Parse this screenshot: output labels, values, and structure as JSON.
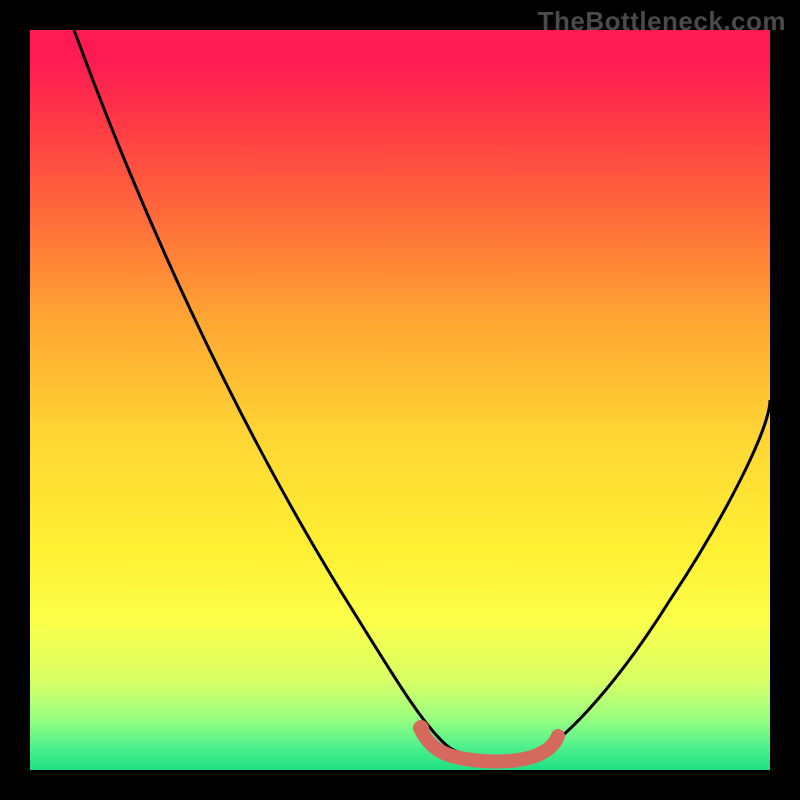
{
  "watermark": "TheBottleneck.com",
  "chart_data": {
    "type": "line",
    "title": "",
    "xlabel": "",
    "ylabel": "",
    "xlim": [
      0,
      100
    ],
    "ylim": [
      0,
      100
    ],
    "gradient_stops": [
      {
        "pos": 0,
        "color": "#ff1a53"
      },
      {
        "pos": 25,
        "color": "#ff6b3a"
      },
      {
        "pos": 55,
        "color": "#ffd633"
      },
      {
        "pos": 80,
        "color": "#fbff4a"
      },
      {
        "pos": 97,
        "color": "#4cf08c"
      },
      {
        "pos": 100,
        "color": "#1ee083"
      }
    ],
    "series": [
      {
        "name": "bottleneck-curve",
        "color": "#000000",
        "points": [
          {
            "x": 6,
            "y": 100
          },
          {
            "x": 20,
            "y": 70
          },
          {
            "x": 35,
            "y": 38
          },
          {
            "x": 48,
            "y": 12
          },
          {
            "x": 54,
            "y": 4
          },
          {
            "x": 58,
            "y": 2
          },
          {
            "x": 64,
            "y": 2
          },
          {
            "x": 70,
            "y": 3
          },
          {
            "x": 78,
            "y": 12
          },
          {
            "x": 90,
            "y": 32
          },
          {
            "x": 100,
            "y": 50
          }
        ]
      },
      {
        "name": "optimal-zone-marker",
        "color": "#d6695e",
        "points": [
          {
            "x": 53,
            "y": 4.5
          },
          {
            "x": 55,
            "y": 3
          },
          {
            "x": 58,
            "y": 2
          },
          {
            "x": 62,
            "y": 1.8
          },
          {
            "x": 66,
            "y": 2
          },
          {
            "x": 69,
            "y": 3
          },
          {
            "x": 70,
            "y": 4
          }
        ]
      }
    ]
  }
}
